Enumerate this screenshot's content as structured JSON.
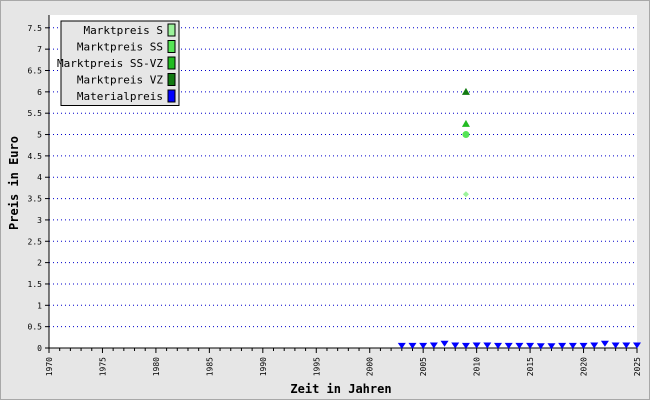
{
  "chart_data": {
    "type": "scatter",
    "title": "",
    "xlabel": "Zeit in Jahren",
    "ylabel": "Preis in Euro",
    "xlim": [
      1970,
      2025
    ],
    "ylim": [
      0,
      7.8
    ],
    "x_ticks": [
      "1970",
      "1975",
      "1980",
      "1985",
      "1990",
      "1995",
      "2000",
      "2005",
      "2010",
      "2015",
      "2020",
      "2025"
    ],
    "y_ticks": [
      "0",
      "0.5",
      "1",
      "1.5",
      "2",
      "2.5",
      "3",
      "3.5",
      "4",
      "4.5",
      "5",
      "5.5",
      "6",
      "6.5",
      "7",
      "7.5"
    ],
    "grid": "horizontal dotted",
    "legend_position": "top-left",
    "series": [
      {
        "name": "Marktpreis S",
        "color": "#9cf29c",
        "marker": "diamond",
        "points": [
          {
            "x": 2009,
            "y": 3.6
          }
        ]
      },
      {
        "name": "Marktpreis SS",
        "color": "#55e455",
        "marker": "circle",
        "points": [
          {
            "x": 2009,
            "y": 5.0
          }
        ]
      },
      {
        "name": "Marktpreis SS-VZ",
        "color": "#22bb22",
        "marker": "triangle",
        "points": [
          {
            "x": 2009,
            "y": 5.25
          }
        ]
      },
      {
        "name": "Marktpreis VZ",
        "color": "#127a12",
        "marker": "triangle",
        "points": [
          {
            "x": 2009,
            "y": 6.0
          }
        ]
      },
      {
        "name": "Materialpreis",
        "color": "#0000ff",
        "marker": "triangle-down",
        "points": [
          {
            "x": 2003,
            "y": 0.05
          },
          {
            "x": 2004,
            "y": 0.05
          },
          {
            "x": 2005,
            "y": 0.05
          },
          {
            "x": 2006,
            "y": 0.06
          },
          {
            "x": 2007,
            "y": 0.1
          },
          {
            "x": 2008,
            "y": 0.06
          },
          {
            "x": 2009,
            "y": 0.05
          },
          {
            "x": 2010,
            "y": 0.06
          },
          {
            "x": 2011,
            "y": 0.06
          },
          {
            "x": 2012,
            "y": 0.05
          },
          {
            "x": 2013,
            "y": 0.05
          },
          {
            "x": 2014,
            "y": 0.05
          },
          {
            "x": 2015,
            "y": 0.05
          },
          {
            "x": 2016,
            "y": 0.04
          },
          {
            "x": 2017,
            "y": 0.04
          },
          {
            "x": 2018,
            "y": 0.05
          },
          {
            "x": 2019,
            "y": 0.05
          },
          {
            "x": 2020,
            "y": 0.05
          },
          {
            "x": 2021,
            "y": 0.06
          },
          {
            "x": 2022,
            "y": 0.1
          },
          {
            "x": 2023,
            "y": 0.06
          },
          {
            "x": 2024,
            "y": 0.06
          },
          {
            "x": 2025,
            "y": 0.06
          }
        ]
      }
    ]
  },
  "colors": {
    "background": "#e6e6e6",
    "plot_area": "#ffffff",
    "grid": "#0000cc",
    "legend_box": "#e6e6e6"
  }
}
